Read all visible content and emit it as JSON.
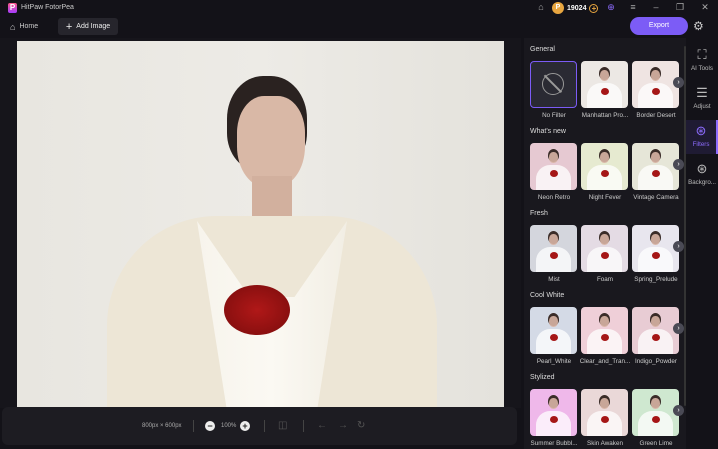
{
  "app": {
    "title": "HitPaw FotorPea",
    "coins": "19024"
  },
  "toolbar": {
    "home": "Home",
    "add_image": "Add Image",
    "export": "Export"
  },
  "bottom": {
    "dimensions": "800px × 600px",
    "zoom": "100%"
  },
  "filters": {
    "sections": [
      {
        "title": "General",
        "items": [
          {
            "label": "No Filter",
            "tint": "#2a2a33",
            "selected": true
          },
          {
            "label": "Manhattan Pro...",
            "tint": "#ece8e4"
          },
          {
            "label": "Border Desert",
            "tint": "#efe4e2"
          }
        ]
      },
      {
        "title": "What's new",
        "items": [
          {
            "label": "Neon Retro",
            "tint": "#e6c9d2"
          },
          {
            "label": "Night Fever",
            "tint": "#e6ead0"
          },
          {
            "label": "Vintage Camera",
            "tint": "#e6e6d8"
          }
        ]
      },
      {
        "title": "Fresh",
        "items": [
          {
            "label": "Mist",
            "tint": "#d4d6dd"
          },
          {
            "label": "Foam",
            "tint": "#e4dbe4"
          },
          {
            "label": "Spring_Prelude",
            "tint": "#e8e6ee"
          }
        ]
      },
      {
        "title": "Cool White",
        "items": [
          {
            "label": "Pearl_White",
            "tint": "#d4dae6"
          },
          {
            "label": "Clear_and_Tran...",
            "tint": "#efcfd8"
          },
          {
            "label": "Indigo_Powder",
            "tint": "#e8ccd4"
          }
        ]
      },
      {
        "title": "Stylized",
        "items": [
          {
            "label": "Summer Bubbl...",
            "tint": "#efb8ea"
          },
          {
            "label": "Skin Awaken",
            "tint": "#ead8d8"
          },
          {
            "label": "Green Lime",
            "tint": "#cfe8d0"
          }
        ]
      }
    ]
  },
  "rail": [
    {
      "label": "AI Tools",
      "icon": "ai-image-icon"
    },
    {
      "label": "Adjust",
      "icon": "sliders-icon"
    },
    {
      "label": "Filters",
      "icon": "filters-icon",
      "active": true
    },
    {
      "label": "Backgro...",
      "icon": "background-icon"
    }
  ],
  "accent": "#7c5cf6"
}
